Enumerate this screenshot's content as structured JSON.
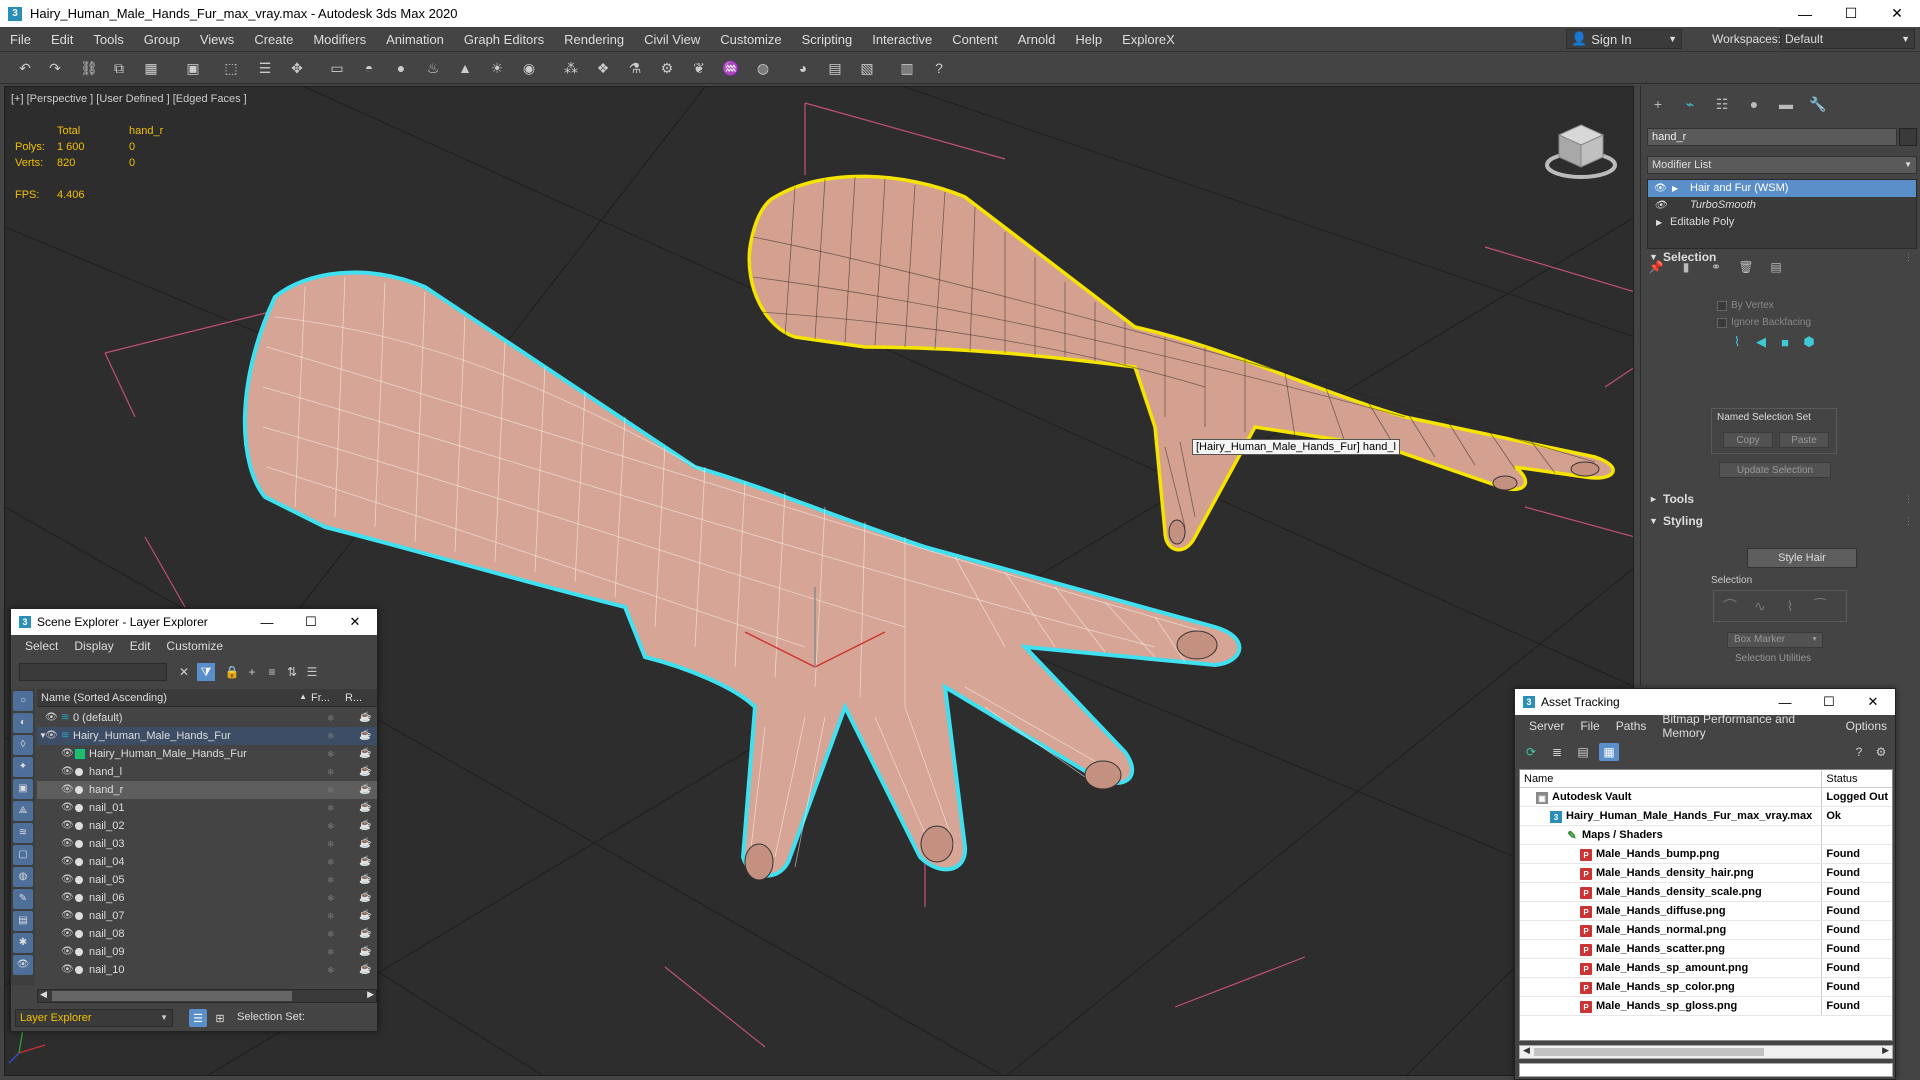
{
  "window": {
    "title": "Hairy_Human_Male_Hands_Fur_max_vray.max - Autodesk 3ds Max 2020",
    "app_icon": "3",
    "minimize": "—",
    "maximize": "☐",
    "close": "✕"
  },
  "menu": [
    "File",
    "Edit",
    "Tools",
    "Group",
    "Views",
    "Create",
    "Modifiers",
    "Animation",
    "Graph Editors",
    "Rendering",
    "Civil View",
    "Customize",
    "Scripting",
    "Interactive",
    "Content",
    "Arnold",
    "Help",
    "ExploreX"
  ],
  "signin": {
    "label": "Sign In",
    "icon": "user-icon"
  },
  "workspaces": {
    "label": "Workspaces:",
    "value": "Default"
  },
  "viewport": {
    "label": "[+] [Perspective ] [User Defined ] [Edged Faces ]",
    "stats": {
      "col_total": "Total",
      "col_obj": "hand_r",
      "polys_label": "Polys:",
      "polys_total": "1 600",
      "polys_obj": "0",
      "verts_label": "Verts:",
      "verts_total": "820",
      "verts_obj": "0"
    },
    "fps_label": "FPS:",
    "fps_value": "4.406",
    "tooltip": "[Hairy_Human_Male_Hands_Fur] hand_l",
    "colors": {
      "selected_outline_yellow": "#f5e400",
      "selected_outline_cyan": "#3fe0f0",
      "skin": "#d4a090",
      "grid": "#cc5577"
    }
  },
  "command_panel": {
    "object_name": "hand_r",
    "modifier_list": "Modifier List",
    "stack": [
      {
        "label": "Hair and Fur (WSM)",
        "selected": true
      },
      {
        "label": "TurboSmooth",
        "selected": false
      },
      {
        "label": "Editable Poly",
        "selected": false
      }
    ],
    "selection_header": "Selection",
    "by_vertex": "By Vertex",
    "ignore_backfacing": "Ignore Backfacing",
    "named_selection_set": "Named Selection Set",
    "copy": "Copy",
    "paste": "Paste",
    "update_selection": "Update Selection",
    "tools_header": "Tools",
    "styling_header": "Styling",
    "style_hair": "Style Hair",
    "selection_label": "Selection",
    "box_marker": "Box Marker",
    "selection_utilities": "Selection Utilities",
    "sign_collapsed": "►",
    "sign_expanded": "▼"
  },
  "scene_explorer": {
    "title": "Scene Explorer - Layer Explorer",
    "menu": [
      "Select",
      "Display",
      "Edit",
      "Customize"
    ],
    "col_name": "Name (Sorted Ascending)",
    "col_freeze": "Fr...",
    "col_render": "R...",
    "rows": [
      {
        "label": "0 (default)",
        "indent": 0
      },
      {
        "label": "Hairy_Human_Male_Hands_Fur",
        "indent": 0
      },
      {
        "label": "Hairy_Human_Male_Hands_Fur",
        "indent": 1
      },
      {
        "label": "hand_l",
        "indent": 1
      },
      {
        "label": "hand_r",
        "indent": 1
      },
      {
        "label": "nail_01",
        "indent": 1
      },
      {
        "label": "nail_02",
        "indent": 1
      },
      {
        "label": "nail_03",
        "indent": 1
      },
      {
        "label": "nail_04",
        "indent": 1
      },
      {
        "label": "nail_05",
        "indent": 1
      },
      {
        "label": "nail_06",
        "indent": 1
      },
      {
        "label": "nail_07",
        "indent": 1
      },
      {
        "label": "nail_08",
        "indent": 1
      },
      {
        "label": "nail_09",
        "indent": 1
      },
      {
        "label": "nail_10",
        "indent": 1
      }
    ],
    "layer_dropdown": "Layer Explorer",
    "selection_set": "Selection Set:"
  },
  "asset_tracking": {
    "title": "Asset Tracking",
    "menu": [
      "Server",
      "File",
      "Paths",
      "Bitmap Performance and Memory",
      "Options"
    ],
    "col_name": "Name",
    "col_status": "Status",
    "rows": [
      {
        "name": "Autodesk Vault",
        "status": "Logged Out",
        "icon": "vault-icon"
      },
      {
        "name": "Hairy_Human_Male_Hands_Fur_max_vray.max",
        "status": "Ok",
        "icon": "max-file-icon"
      },
      {
        "name": "Maps / Shaders",
        "status": "",
        "icon": "maps-icon"
      },
      {
        "name": "Male_Hands_bump.png",
        "status": "Found",
        "icon": "png-icon"
      },
      {
        "name": "Male_Hands_density_hair.png",
        "status": "Found",
        "icon": "png-icon"
      },
      {
        "name": "Male_Hands_density_scale.png",
        "status": "Found",
        "icon": "png-icon"
      },
      {
        "name": "Male_Hands_diffuse.png",
        "status": "Found",
        "icon": "png-icon"
      },
      {
        "name": "Male_Hands_normal.png",
        "status": "Found",
        "icon": "png-icon"
      },
      {
        "name": "Male_Hands_scatter.png",
        "status": "Found",
        "icon": "png-icon"
      },
      {
        "name": "Male_Hands_sp_amount.png",
        "status": "Found",
        "icon": "png-icon"
      },
      {
        "name": "Male_Hands_sp_color.png",
        "status": "Found",
        "icon": "png-icon"
      },
      {
        "name": "Male_Hands_sp_gloss.png",
        "status": "Found",
        "icon": "png-icon"
      }
    ]
  }
}
